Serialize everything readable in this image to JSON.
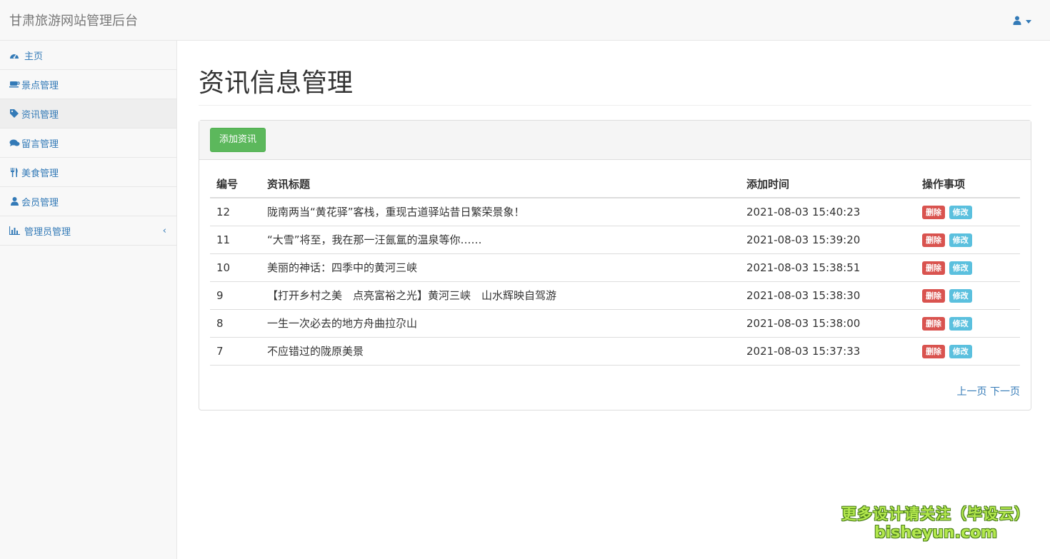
{
  "app": {
    "title": "甘肃旅游网站管理后台"
  },
  "user_menu": {
    "icon": "user-icon"
  },
  "sidebar": {
    "items": [
      {
        "label": "主页",
        "icon": "dashboard-icon"
      },
      {
        "label": "景点管理",
        "icon": "coffee-icon"
      },
      {
        "label": "资讯管理",
        "icon": "tag-icon"
      },
      {
        "label": "留言管理",
        "icon": "comments-icon"
      },
      {
        "label": "美食管理",
        "icon": "cutlery-icon"
      },
      {
        "label": "会员管理",
        "icon": "user-icon"
      },
      {
        "label": "管理员管理",
        "icon": "bar-chart-icon",
        "chevron": "‹"
      }
    ],
    "active_index": 2
  },
  "main": {
    "title": "资讯信息管理",
    "add_button": "添加资讯",
    "table": {
      "headers": [
        "编号",
        "资讯标题",
        "添加时间",
        "操作事项"
      ],
      "rows": [
        {
          "id": "12",
          "title": "陇南两当“黄花驿”客栈，重现古道驿站昔日繁荣景象！",
          "time": "2021-08-03 15:40:23"
        },
        {
          "id": "11",
          "title": "“大雪”将至，我在那一汪氤氲的温泉等你……",
          "time": "2021-08-03 15:39:20"
        },
        {
          "id": "10",
          "title": "美丽的神话：四季中的黄河三峡",
          "time": "2021-08-03 15:38:51"
        },
        {
          "id": "9",
          "title": "【打开乡村之美　点亮富裕之光】黄河三峡　山水辉映自驾游",
          "time": "2021-08-03 15:38:30"
        },
        {
          "id": "8",
          "title": "一生一次必去的地方舟曲拉尕山",
          "time": "2021-08-03 15:38:00"
        },
        {
          "id": "7",
          "title": "不应错过的陇原美景",
          "time": "2021-08-03 15:37:33"
        }
      ],
      "delete_label": "删除",
      "edit_label": "修改"
    },
    "pager": {
      "prev": "上一页",
      "next": "下一页"
    }
  },
  "watermark": {
    "line1": "更多设计请关注（毕设云）",
    "line2": "bisheyun.com"
  },
  "colors": {
    "link": "#337ab7",
    "success": "#5cb85c",
    "danger": "#d9534f",
    "info": "#5bc0de"
  }
}
